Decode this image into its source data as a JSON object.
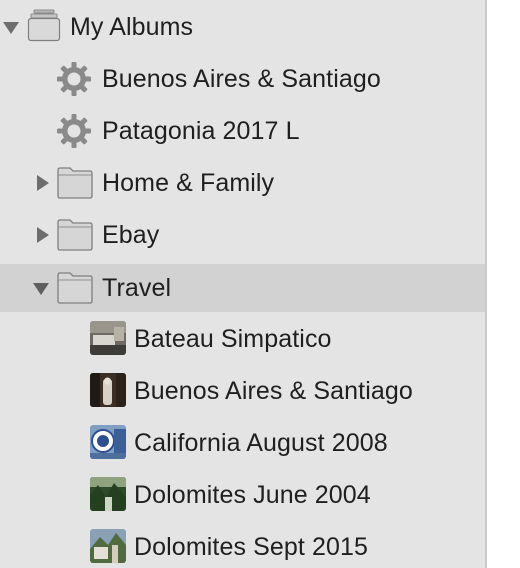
{
  "sidebar": {
    "my_albums": {
      "label": "My Albums",
      "icon": "albums-stack-icon",
      "expanded": true
    },
    "smart_albums": [
      {
        "label": "Buenos Aires & Santiago",
        "icon": "gear-icon"
      },
      {
        "label": "Patagonia 2017 L",
        "icon": "gear-icon"
      }
    ],
    "folders": [
      {
        "label": "Home & Family",
        "icon": "folder-icon",
        "expanded": false
      },
      {
        "label": "Ebay",
        "icon": "folder-icon",
        "expanded": false
      },
      {
        "label": "Travel",
        "icon": "folder-icon",
        "expanded": true,
        "selected": true
      }
    ],
    "travel_albums": [
      {
        "label": "Bateau Simpatico",
        "icon": "album-thumbnail-icon"
      },
      {
        "label": "Buenos Aires & Santiago",
        "icon": "album-thumbnail-icon"
      },
      {
        "label": "California August 2008",
        "icon": "album-thumbnail-icon"
      },
      {
        "label": "Dolomites June 2004",
        "icon": "album-thumbnail-icon"
      },
      {
        "label": "Dolomites Sept 2015",
        "icon": "album-thumbnail-icon"
      }
    ]
  },
  "colors": {
    "sidebar_bg": "#e4e4e4",
    "selected_row_bg": "#d2d2d2",
    "text": "#1f1f1f",
    "icon_gray": "#8a8a8a"
  }
}
